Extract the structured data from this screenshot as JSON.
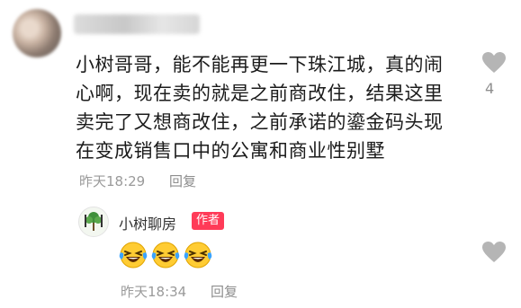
{
  "comment": {
    "text": "小树哥哥，能不能再更一下珠江城，真的闹\n心啊，现在卖的就是之前商改住，结果这里\n卖完了又想商改住，之前承诺的鎏金码头现\n在变成销售口中的公寓和商业性别墅",
    "time": "昨天18:29",
    "reply_label": "回复",
    "like_count": "4"
  },
  "reply": {
    "username": "小树聊房",
    "badge": "作者",
    "emojis": [
      "laughing-crying-emoji",
      "laughing-crying-emoji",
      "laughing-crying-emoji"
    ],
    "time": "昨天18:34",
    "reply_label": "回复"
  },
  "colors": {
    "badge_bg": "#ff3b58",
    "meta_text": "#9a9a9a",
    "heart": "#b5b5b5"
  },
  "icons": {
    "like": "heart-icon"
  }
}
